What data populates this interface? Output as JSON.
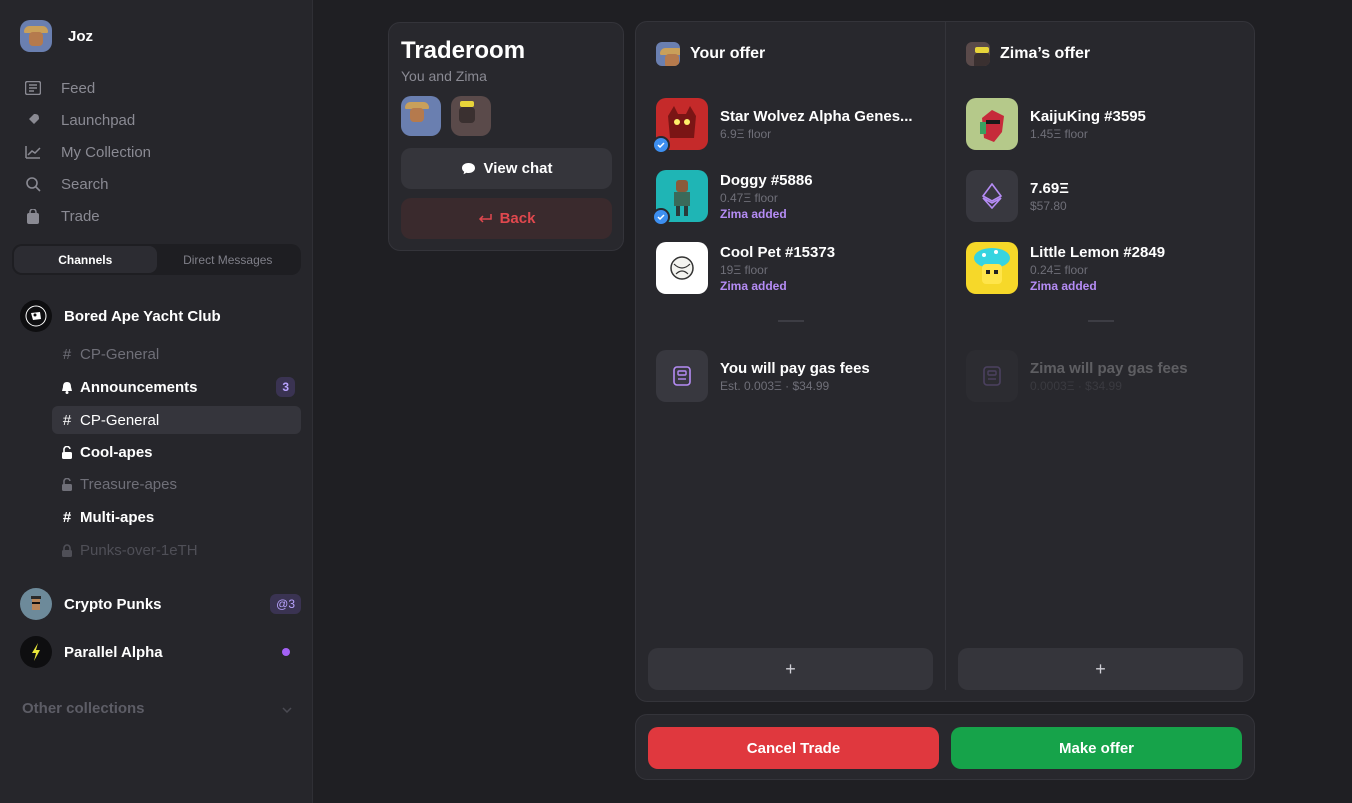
{
  "user": {
    "name": "Joz"
  },
  "nav": [
    {
      "label": "Feed",
      "icon": "feed-icon"
    },
    {
      "label": "Launchpad",
      "icon": "rocket-icon"
    },
    {
      "label": "My Collection",
      "icon": "chart-icon"
    },
    {
      "label": "Search",
      "icon": "search-icon"
    },
    {
      "label": "Trade",
      "icon": "bag-icon"
    }
  ],
  "tabs": {
    "channels": "Channels",
    "direct": "Direct Messages"
  },
  "collections": [
    {
      "name": "Bored Ape Yacht Club"
    },
    {
      "name": "Crypto Punks",
      "badge": "@3"
    },
    {
      "name": "Parallel Alpha"
    }
  ],
  "channels": [
    {
      "label": "CP-General",
      "icon": "#"
    },
    {
      "label": "Announcements",
      "badge": "3"
    },
    {
      "label": "CP-General",
      "icon": "#"
    },
    {
      "label": "Cool-apes"
    },
    {
      "label": "Treasure-apes"
    },
    {
      "label": "Multi-apes",
      "icon": "#"
    },
    {
      "label": "Punks-over-1eTH"
    }
  ],
  "other_collections": "Other collections",
  "traderoom": {
    "title": "Traderoom",
    "subtitle": "You and Zima",
    "view_chat": "View chat",
    "back": "Back"
  },
  "your_offer": {
    "title": "Your offer",
    "items": [
      {
        "name": "Star Wolvez Alpha Genes...",
        "sub": "6.9Ξ floor"
      },
      {
        "name": "Doggy #5886",
        "sub": "0.47Ξ floor",
        "added": "Zima added"
      },
      {
        "name": "Cool Pet #15373",
        "sub": "19Ξ floor",
        "added": "Zima added"
      }
    ],
    "gas": {
      "title": "You will pay gas fees",
      "sub": "Est. 0.003Ξ · $34.99"
    }
  },
  "zima_offer": {
    "title": "Zima’s offer",
    "items": [
      {
        "name": "KaijuKing #3595",
        "sub": "1.45Ξ floor"
      },
      {
        "name": "7.69Ξ",
        "sub": "$57.80"
      },
      {
        "name": "Little Lemon #2849",
        "sub": "0.24Ξ floor",
        "added": "Zima added"
      }
    ],
    "gas": {
      "title": "Zima will pay gas fees",
      "sub": "0.0003Ξ · $34.99"
    }
  },
  "add_symbol": "+",
  "actions": {
    "cancel": "Cancel Trade",
    "make": "Make offer"
  },
  "colors": {
    "cancel": "#e0383e",
    "make": "#16a34a",
    "accent": "#b58cf5",
    "verified": "#3d8ff0"
  }
}
